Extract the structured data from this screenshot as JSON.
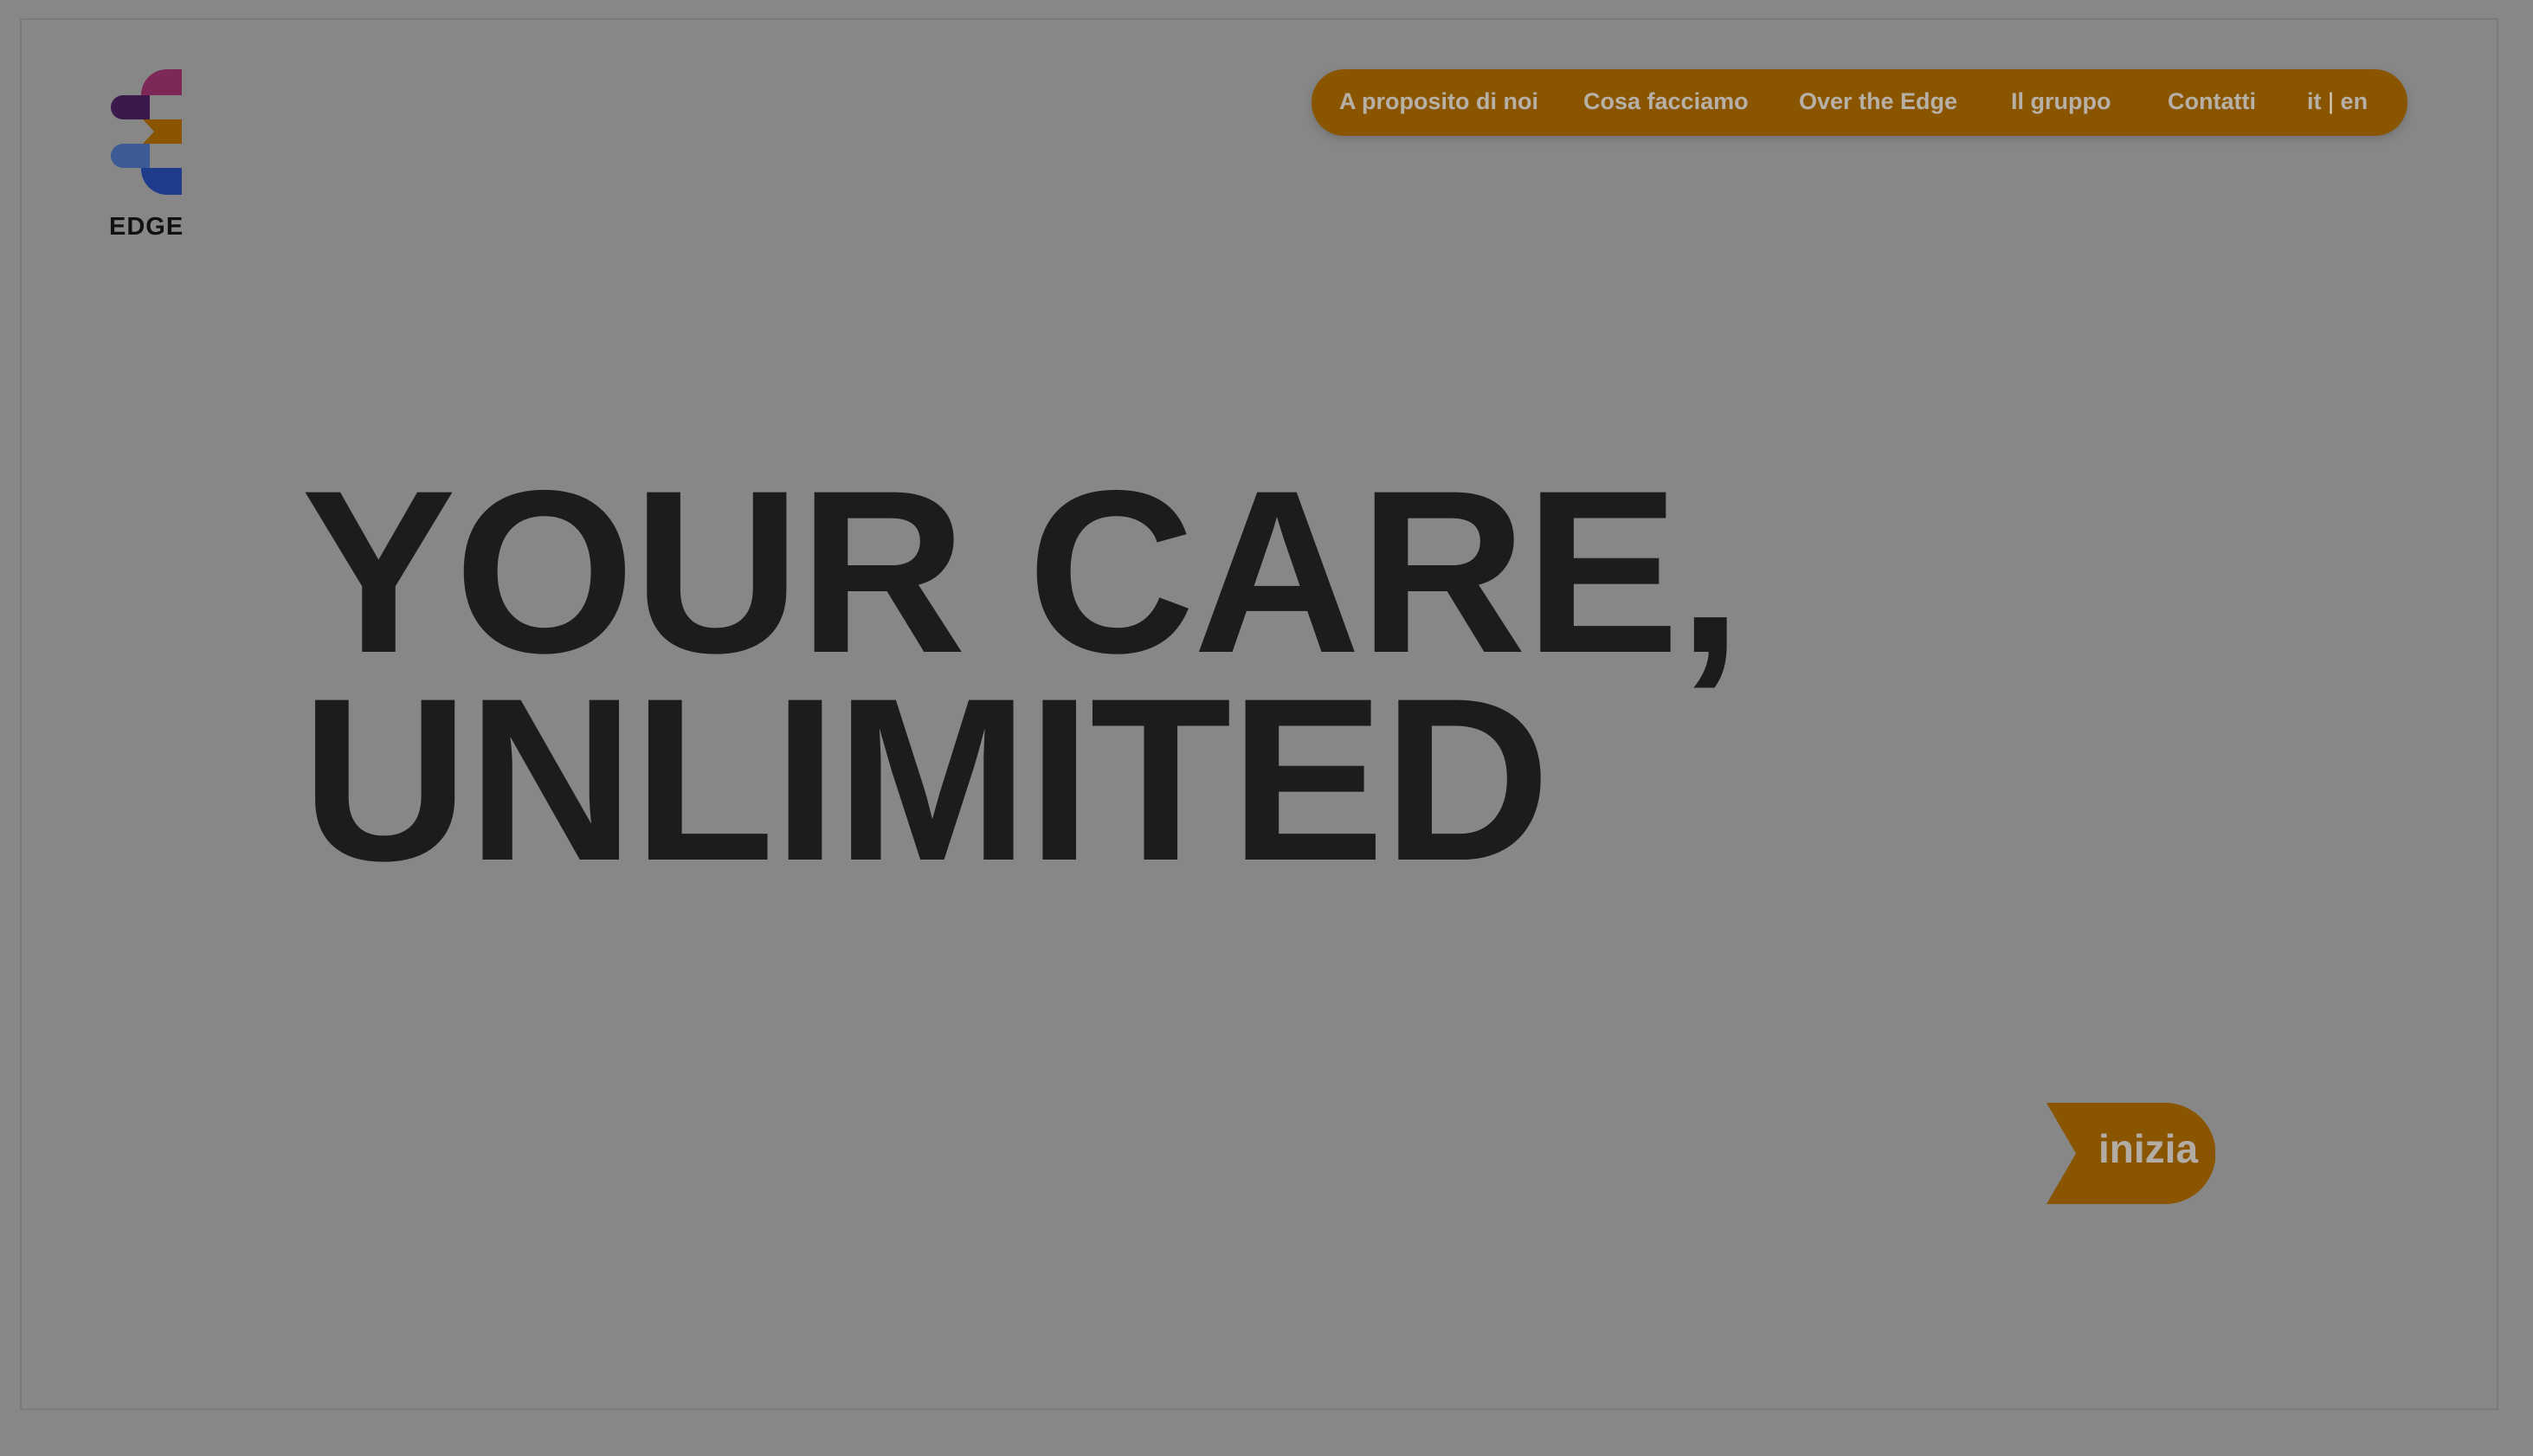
{
  "brand": {
    "name": "EDGE",
    "logo_icon": "edge-logo-icon",
    "logo_colors": [
      "#3a1a4a",
      "#7e2858",
      "#8a5500",
      "#3e5a96",
      "#1f3b8c"
    ]
  },
  "nav": {
    "background": "#8a5500",
    "items": [
      {
        "label": "A proposito di noi"
      },
      {
        "label": "Cosa facciamo"
      },
      {
        "label": "Over the Edge"
      },
      {
        "label": "Il gruppo"
      },
      {
        "label": "Contatti"
      }
    ],
    "lang": {
      "it": "it",
      "separator": "|",
      "en": "en"
    }
  },
  "hero": {
    "line1": "YOUR CARE,",
    "line2": "UNLIMITED"
  },
  "cta": {
    "label": "inizia",
    "background": "#8a5500"
  },
  "colors": {
    "overlay": "#878787",
    "heading": "#1c1c1c",
    "accent": "#8a5500"
  }
}
